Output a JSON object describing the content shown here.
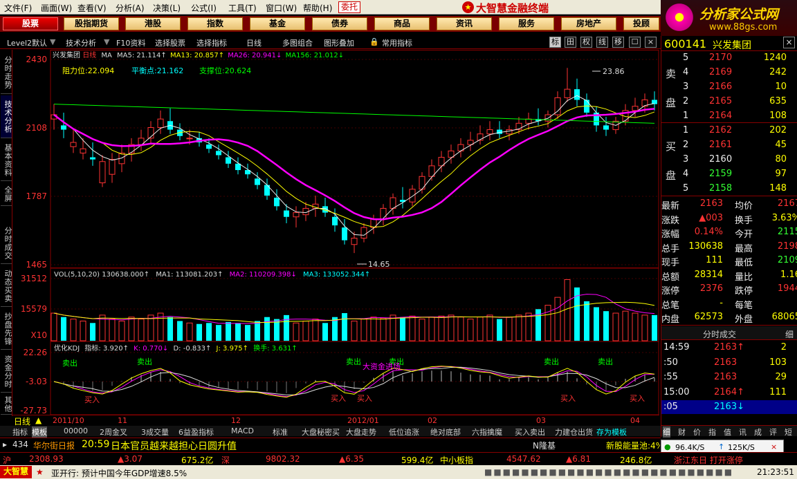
{
  "menu": {
    "items": [
      "文件(F)",
      "画面(W)",
      "查看(V)",
      "分析(A)",
      "决策(L)",
      "公式(I)",
      "工具(T)",
      "窗口(W)",
      "帮助(H)"
    ],
    "delegate": "委托",
    "app_title": "大智慧金融终端"
  },
  "brand": {
    "name": "分析家公式网",
    "url": "www.88gs.com"
  },
  "categories": [
    "股票",
    "股指期货",
    "港股",
    "指数",
    "基金",
    "债券",
    "商品",
    "资讯",
    "服务",
    "房地产",
    "投顾"
  ],
  "toolbar": {
    "items": [
      "Level2默认",
      "技术分析",
      "F10资料",
      "选择股票",
      "选择指标",
      "日线",
      "多图组合",
      "图形叠加",
      "常用指标"
    ],
    "icons": [
      "标",
      "田",
      "权",
      "线",
      "移",
      "☐"
    ]
  },
  "left_tabs": [
    "分时走势",
    "技术分析",
    "基本资料",
    "全屏",
    "分时成交",
    "动态买卖",
    "抄盘先锋",
    "资金分时",
    "其他"
  ],
  "chart": {
    "price_axis": [
      "2430",
      "2108",
      "1787",
      "1465"
    ],
    "vol_axis": [
      "31512",
      "15579",
      "X10"
    ],
    "kdj_axis": [
      "22.26",
      "-3.03",
      "-27.73"
    ],
    "header": {
      "name": "兴发集团",
      "period": "日线",
      "ma_label": "MA",
      "ma5": "MA5: 21.114↑",
      "ma13": "MA13: 20.857↑",
      "ma26": "MA26: 20.941↓",
      "ma156": "MA156: 21.012↓"
    },
    "levels": {
      "resist": "阻力位:22.094",
      "balance": "平衡点:21.162",
      "support": "支撑位:20.624"
    },
    "hi_label": "23.86",
    "lo_label": "14.65",
    "vol_header": {
      "vol": "VOL(5,10,20) 130638.000↑",
      "ma1": "MA1: 113081.203↑",
      "ma2": "MA2: 110209.398↓",
      "ma3": "MA3: 133052.344↑"
    },
    "kdj_header": {
      "name": "优化KDJ",
      "idx": "指标: 3.920↑",
      "k": "K: 0.770↓",
      "d": "D: -0.833↑",
      "j": "J: 3.975↑",
      "turn": "换手: 3.631↑"
    },
    "sell_label": "卖出",
    "buy_label": "买入",
    "fund_label": "大资金进场",
    "dates": [
      "2011/10",
      "11",
      "12",
      "2012/01",
      "02",
      "03",
      "04"
    ],
    "period_label": "日线"
  },
  "chart_data": {
    "type": "candlestick",
    "title": "兴发集团 日线",
    "ylim": [
      14.65,
      24.3
    ],
    "candles": [
      [
        21.5,
        22.2,
        21.0,
        21.7
      ],
      [
        21.2,
        21.8,
        20.6,
        21.0
      ],
      [
        20.2,
        21.0,
        19.9,
        20.4
      ],
      [
        19.9,
        20.6,
        19.6,
        20.1
      ],
      [
        19.7,
        20.4,
        19.3,
        19.6
      ],
      [
        18.5,
        19.8,
        18.3,
        19.5
      ],
      [
        18.9,
        19.9,
        18.5,
        19.6
      ],
      [
        19.4,
        20.3,
        19.0,
        19.9
      ],
      [
        19.9,
        20.6,
        19.5,
        20.3
      ],
      [
        20.3,
        21.0,
        20.0,
        20.6
      ],
      [
        20.6,
        21.4,
        20.3,
        21.1
      ],
      [
        21.1,
        21.9,
        20.8,
        21.5
      ],
      [
        21.4,
        22.0,
        20.8,
        21.0
      ],
      [
        21.0,
        21.3,
        20.5,
        20.7
      ],
      [
        20.6,
        21.0,
        20.3,
        20.6
      ],
      [
        20.6,
        20.9,
        20.2,
        20.4
      ],
      [
        20.3,
        20.6,
        19.9,
        20.1
      ],
      [
        20.0,
        20.3,
        19.6,
        19.8
      ],
      [
        19.7,
        20.0,
        19.2,
        19.4
      ],
      [
        19.4,
        19.7,
        18.9,
        19.1
      ],
      [
        19.1,
        19.4,
        18.7,
        18.9
      ],
      [
        18.7,
        19.0,
        18.2,
        18.4
      ],
      [
        18.4,
        18.7,
        17.7,
        17.9
      ],
      [
        17.8,
        18.2,
        17.2,
        17.4
      ],
      [
        17.2,
        17.5,
        16.6,
        16.9
      ],
      [
        16.9,
        17.4,
        16.4,
        17.1
      ],
      [
        17.0,
        17.6,
        16.7,
        17.3
      ],
      [
        17.3,
        17.9,
        16.9,
        17.5
      ],
      [
        17.4,
        17.8,
        16.9,
        17.1
      ],
      [
        16.9,
        17.3,
        16.2,
        16.5
      ],
      [
        16.4,
        16.8,
        15.6,
        15.8
      ],
      [
        15.6,
        16.2,
        15.2,
        15.9
      ],
      [
        15.9,
        16.6,
        15.7,
        16.4
      ],
      [
        16.4,
        17.0,
        16.1,
        16.8
      ],
      [
        16.8,
        17.5,
        16.5,
        17.3
      ],
      [
        17.3,
        18.0,
        17.0,
        17.8
      ],
      [
        17.7,
        18.3,
        17.3,
        17.6
      ],
      [
        17.6,
        18.4,
        17.4,
        18.2
      ],
      [
        18.2,
        19.0,
        18.0,
        18.8
      ],
      [
        18.8,
        19.6,
        18.6,
        19.3
      ],
      [
        19.3,
        20.0,
        19.0,
        19.7
      ],
      [
        19.7,
        20.3,
        19.4,
        20.0
      ],
      [
        20.0,
        20.6,
        19.7,
        20.3
      ],
      [
        20.3,
        20.9,
        20.0,
        20.5
      ],
      [
        20.5,
        21.2,
        20.3,
        20.8
      ],
      [
        20.8,
        21.4,
        20.5,
        21.0
      ],
      [
        21.0,
        21.4,
        20.6,
        20.8
      ],
      [
        20.8,
        21.2,
        20.5,
        21.0
      ],
      [
        21.0,
        21.6,
        20.8,
        21.3
      ],
      [
        21.3,
        21.8,
        21.0,
        21.5
      ],
      [
        21.5,
        22.0,
        21.2,
        21.4
      ],
      [
        21.4,
        21.9,
        21.1,
        21.7
      ],
      [
        21.7,
        22.8,
        21.5,
        22.5
      ],
      [
        22.5,
        23.9,
        22.3,
        22.9
      ],
      [
        22.9,
        23.4,
        22.1,
        22.4
      ],
      [
        22.4,
        22.7,
        21.6,
        21.8
      ],
      [
        21.8,
        22.1,
        20.9,
        21.2
      ],
      [
        21.2,
        21.6,
        20.7,
        21.0
      ],
      [
        21.0,
        21.6,
        20.8,
        21.4
      ],
      [
        21.4,
        22.2,
        21.2,
        21.9
      ],
      [
        21.9,
        22.5,
        21.6,
        22.1
      ],
      [
        22.1,
        22.7,
        21.8,
        22.4
      ],
      [
        22.4,
        22.8,
        21.9,
        22.2
      ]
    ],
    "ma_series": [
      {
        "name": "MA5"
      },
      {
        "name": "MA13"
      },
      {
        "name": "MA26"
      },
      {
        "name": "MA156"
      }
    ],
    "volume_ylim": [
      0,
      31512
    ],
    "volume": [
      14000,
      12000,
      11000,
      10000,
      9000,
      13000,
      11000,
      10000,
      12000,
      11000,
      13000,
      14000,
      12000,
      10000,
      9000,
      8500,
      9000,
      8000,
      9500,
      9000,
      8000,
      10000,
      12000,
      11000,
      13000,
      9000,
      10000,
      11000,
      9000,
      12000,
      14000,
      10000,
      11000,
      12000,
      11500,
      13000,
      12000,
      12500,
      11000,
      12000,
      12500,
      13000,
      12000,
      11000,
      12000,
      13000,
      11000,
      12000,
      13000,
      14000,
      16000,
      18000,
      22000,
      31000,
      27000,
      20000,
      17000,
      15000,
      14000,
      15000,
      14000,
      13000,
      13000
    ]
  },
  "quote": {
    "code": "600141",
    "name": "兴发集团",
    "sell_label": "卖",
    "pan_label": "盘",
    "buy_label": "买",
    "asks": [
      {
        "lvl": "5",
        "p": "2170",
        "v": "1240"
      },
      {
        "lvl": "4",
        "p": "2169",
        "v": "242"
      },
      {
        "lvl": "3",
        "p": "2166",
        "v": "10"
      },
      {
        "lvl": "2",
        "p": "2165",
        "v": "635"
      },
      {
        "lvl": "1",
        "p": "2164",
        "v": "108"
      }
    ],
    "bids": [
      {
        "lvl": "1",
        "p": "2162",
        "v": "202"
      },
      {
        "lvl": "2",
        "p": "2161",
        "v": "45"
      },
      {
        "lvl": "3",
        "p": "2160",
        "v": "80"
      },
      {
        "lvl": "4",
        "p": "2159",
        "v": "97"
      },
      {
        "lvl": "5",
        "p": "2158",
        "v": "148"
      }
    ],
    "stats": [
      [
        "最新",
        "2163",
        "均价",
        "2167"
      ],
      [
        "涨跌",
        "▲003",
        "换手",
        "3.63%"
      ],
      [
        "涨幅",
        "0.14%",
        "今开",
        "2115"
      ],
      [
        "总手",
        "130638",
        "最高",
        "2198"
      ],
      [
        "现手",
        "111",
        "最低",
        "2109"
      ],
      [
        "总额",
        "28314",
        "量比",
        "1.16"
      ],
      [
        "涨停",
        "2376",
        "跌停",
        "1944"
      ],
      [
        "总笔",
        "-",
        "每笔",
        "-"
      ],
      [
        "内盘",
        "62573",
        "外盘",
        "68065"
      ]
    ],
    "ticks_title": "分时成交",
    "ticks_tab": "细",
    "ticks": [
      [
        "14:59",
        "2163↑",
        "2"
      ],
      [
        ":50",
        "2163",
        "103"
      ],
      [
        ":55",
        "2163",
        "29"
      ],
      [
        "15:00",
        "2164↑",
        "111"
      ],
      [
        ":05",
        "2163↓",
        ""
      ]
    ],
    "bottom_tabs": [
      "细",
      "财",
      "价",
      "指",
      "值",
      "讯",
      "成",
      "评",
      "短"
    ]
  },
  "bottom_tabs": [
    "指标",
    "模板",
    "00000",
    "2周金叉",
    "3成交量",
    "6益盈指标",
    "MACD",
    "标准",
    "大盘秘密买",
    "大盘走势",
    "低位追涨",
    "绝对底部",
    "六指擒魔",
    "买入卖出",
    "力建仓出货",
    "存为模板"
  ],
  "news": {
    "num": "434",
    "source": "华尔街日报",
    "time": "20:59",
    "text": "日本官员越来越担心日圆升值",
    "right": "N隆基",
    "right2": "新股能量池:4%"
  },
  "index": {
    "sh_label": "沪",
    "sh_val": "2308.93",
    "sh_chg": "▲3.07",
    "sh_amt": "675.2亿",
    "sz_label": "深",
    "sz_val": "9802.32",
    "sz_chg": "▲6.35",
    "sz_amt": "599.4亿",
    "zx_label": "中小板指",
    "zx_val": "4547.62",
    "zx_chg": "▲6.81",
    "zx_amt": "246.8亿",
    "scroll": "浙江东日 打开涨停"
  },
  "status": {
    "app": "大智慧",
    "news": "亚开行: 预计中国今年GDP增速8.5%",
    "time": "21:23:51"
  },
  "net": {
    "down": "96.4K/S",
    "up": "125K/S"
  }
}
